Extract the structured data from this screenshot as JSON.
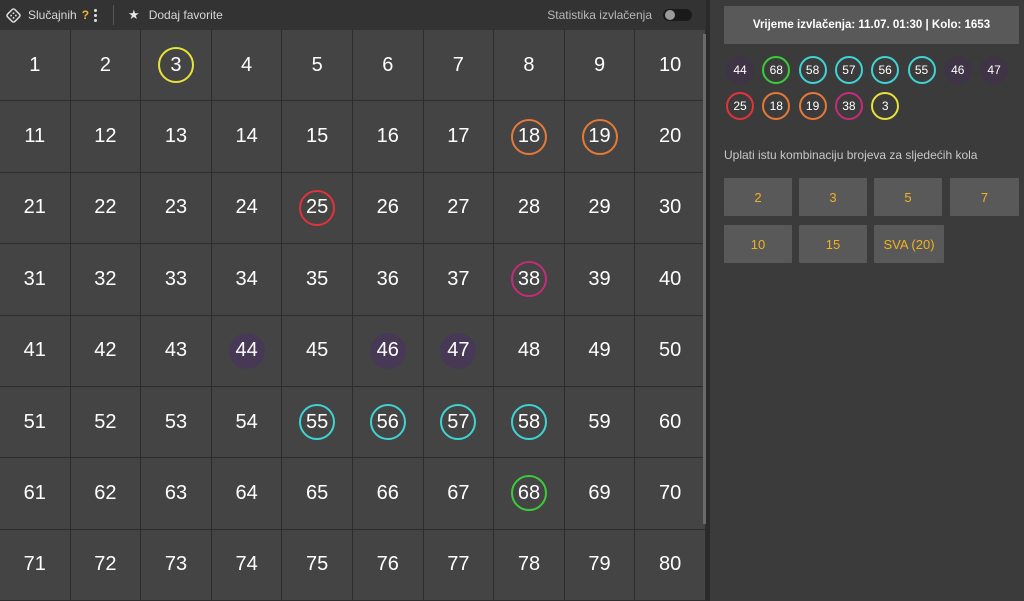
{
  "toolbar": {
    "random_label": "Slučajnih",
    "question_mark": "?",
    "favorites_label": "Dodaj favorite",
    "stats_label": "Statistika izvlačenja",
    "stats_toggle_on": false,
    "dice_icon": "dice-icon",
    "star_icon": "star-icon"
  },
  "colors": {
    "yellow": "#e8e23a",
    "orange": "#e5793a",
    "red": "#e2333a",
    "magenta": "#c42c7a",
    "purple_dim": "#4b2d6a",
    "cyan": "#3fd4d4",
    "green": "#3bcc3b",
    "accent": "#f1b21f"
  },
  "grid": {
    "numbers": [
      1,
      2,
      3,
      4,
      5,
      6,
      7,
      8,
      9,
      10,
      11,
      12,
      13,
      14,
      15,
      16,
      17,
      18,
      19,
      20,
      21,
      22,
      23,
      24,
      25,
      26,
      27,
      28,
      29,
      30,
      31,
      32,
      33,
      34,
      35,
      36,
      37,
      38,
      39,
      40,
      41,
      42,
      43,
      44,
      45,
      46,
      47,
      48,
      49,
      50,
      51,
      52,
      53,
      54,
      55,
      56,
      57,
      58,
      59,
      60,
      61,
      62,
      63,
      64,
      65,
      66,
      67,
      68,
      69,
      70,
      71,
      72,
      73,
      74,
      75,
      76,
      77,
      78,
      79,
      80
    ],
    "highlighted": {
      "3": "yellow",
      "18": "orange",
      "19": "orange",
      "25": "red",
      "38": "magenta",
      "44": "purple_dim",
      "46": "purple_dim",
      "47": "purple_dim",
      "55": "cyan",
      "56": "cyan",
      "57": "cyan",
      "58": "cyan",
      "68": "green"
    }
  },
  "draw": {
    "info": "Vrijeme izvlačenja: 11.07. 01:30 | Kolo: 1653",
    "balls": [
      {
        "n": "44",
        "c": "purple_dim"
      },
      {
        "n": "68",
        "c": "green"
      },
      {
        "n": "58",
        "c": "cyan"
      },
      {
        "n": "57",
        "c": "cyan"
      },
      {
        "n": "56",
        "c": "cyan"
      },
      {
        "n": "55",
        "c": "cyan"
      },
      {
        "n": "46",
        "c": "purple_dim"
      },
      {
        "n": "47",
        "c": "purple_dim"
      },
      {
        "n": "25",
        "c": "red"
      },
      {
        "n": "18",
        "c": "orange"
      },
      {
        "n": "19",
        "c": "orange"
      },
      {
        "n": "38",
        "c": "magenta"
      },
      {
        "n": "3",
        "c": "yellow"
      }
    ]
  },
  "repeat": {
    "label": "Uplati istu kombinaciju brojeva za sljedećih kola",
    "options": [
      "2",
      "3",
      "5",
      "7",
      "10",
      "15",
      "SVA (20)"
    ]
  }
}
